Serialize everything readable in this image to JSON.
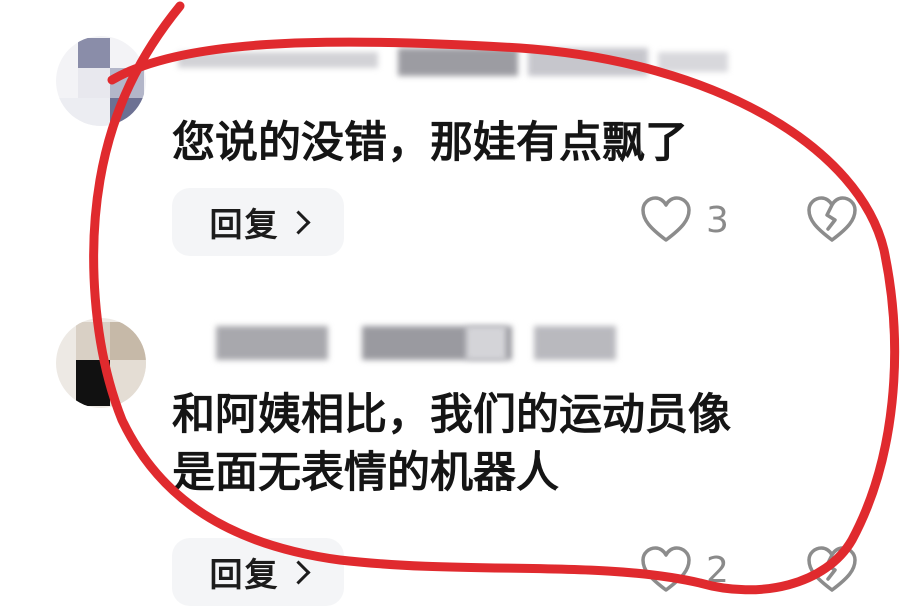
{
  "comments": [
    {
      "text_lines": [
        "您说的没错，那娃有点飘了"
      ],
      "reply_label": "回复",
      "like_count": "3"
    },
    {
      "text_lines": [
        "和阿姨相比，我们的运动员像",
        "是面无表情的机器人"
      ],
      "reply_label": "回复",
      "like_count": "2"
    }
  ],
  "colors": {
    "annotation_stroke": "#e02a2e",
    "comment_text": "#151515",
    "reply_background": "#f4f5f7",
    "count_text": "#8a8a8a",
    "icon_stroke": "#8c8c8c"
  }
}
